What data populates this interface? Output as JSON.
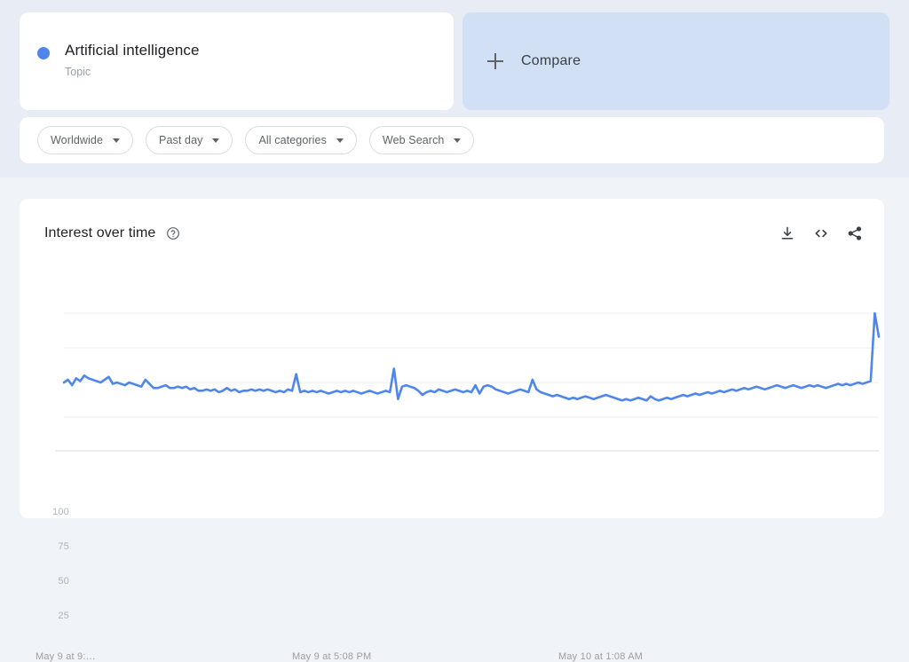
{
  "colors": {
    "series": "#5086ec",
    "top_background": "#e8ecf5",
    "page_background": "#f0f3f8",
    "card": "#ffffff",
    "compare_panel": "#d2e0f5",
    "grid": "#ececec",
    "axis_text": "#b0b4ba"
  },
  "search_term": {
    "title": "Artificial intelligence",
    "type_label": "Topic",
    "dot_icon": "series-dot-icon"
  },
  "compare": {
    "label": "Compare",
    "icon": "plus-icon"
  },
  "filters": [
    {
      "label": "Worldwide",
      "name": "location-filter"
    },
    {
      "label": "Past day",
      "name": "time-range-filter"
    },
    {
      "label": "All categories",
      "name": "category-filter"
    },
    {
      "label": "Web Search",
      "name": "search-type-filter"
    }
  ],
  "chart_panel": {
    "title": "Interest over time",
    "help_icon": "help-circle-icon",
    "actions": [
      {
        "name": "download-icon",
        "label": "Download"
      },
      {
        "name": "embed-code-icon",
        "label": "Embed"
      },
      {
        "name": "share-icon",
        "label": "Share"
      }
    ]
  },
  "chart_data": {
    "type": "line",
    "title": "Interest over time",
    "xlabel": "",
    "ylabel": "",
    "ylim": [
      0,
      100
    ],
    "yticks": [
      25,
      50,
      75,
      100
    ],
    "grid": true,
    "legend": false,
    "xticks": [
      "May 9 at 9:…",
      "May 9 at 5:08 PM",
      "May 10 at 1:08 AM"
    ],
    "xtick_positions": [
      0,
      0.345,
      0.69
    ],
    "series": [
      {
        "name": "Artificial intelligence",
        "color": "#5086ec",
        "values": [
          50,
          52,
          48,
          53,
          51,
          55,
          53,
          52,
          51,
          50,
          52,
          54,
          49,
          50,
          49,
          48,
          50,
          49,
          48,
          47,
          52,
          49,
          46,
          46,
          47,
          48,
          46,
          46,
          47,
          46,
          47,
          45,
          46,
          44,
          44,
          45,
          44,
          45,
          43,
          44,
          46,
          44,
          45,
          43,
          44,
          44,
          45,
          44,
          45,
          44,
          45,
          44,
          43,
          44,
          43,
          45,
          44,
          56,
          43,
          44,
          43,
          44,
          43,
          44,
          43,
          42,
          43,
          44,
          43,
          44,
          43,
          44,
          43,
          42,
          43,
          44,
          43,
          42,
          43,
          44,
          43,
          60,
          38,
          47,
          48,
          47,
          46,
          44,
          41,
          43,
          44,
          43,
          45,
          44,
          43,
          44,
          45,
          44,
          43,
          44,
          43,
          48,
          42,
          47,
          48,
          47,
          45,
          44,
          43,
          42,
          43,
          44,
          45,
          44,
          43,
          52,
          45,
          43,
          42,
          41,
          40,
          41,
          40,
          39,
          38,
          39,
          38,
          39,
          40,
          39,
          38,
          39,
          40,
          41,
          40,
          39,
          38,
          37,
          38,
          37,
          38,
          39,
          38,
          37,
          40,
          38,
          37,
          38,
          39,
          38,
          39,
          40,
          41,
          40,
          41,
          42,
          41,
          42,
          43,
          42,
          43,
          44,
          43,
          44,
          45,
          44,
          45,
          46,
          45,
          46,
          47,
          46,
          45,
          46,
          47,
          48,
          47,
          46,
          47,
          48,
          47,
          46,
          47,
          48,
          47,
          48,
          47,
          46,
          47,
          48,
          49,
          48,
          49,
          48,
          49,
          50,
          49,
          50,
          51,
          100,
          83
        ]
      }
    ]
  }
}
